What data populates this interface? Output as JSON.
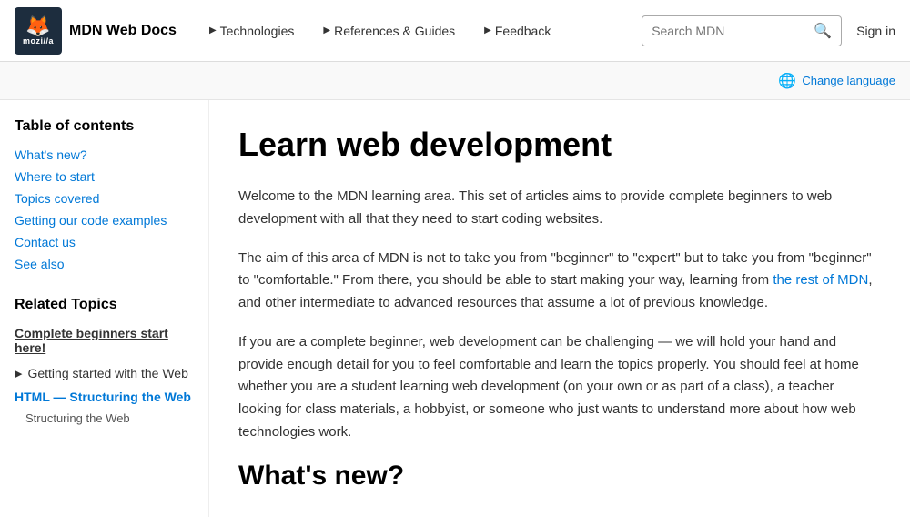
{
  "header": {
    "logo_main": "MDN Web Docs",
    "logo_sub": "mozi//a",
    "nav": [
      {
        "label": "Technologies",
        "arrow": "▶"
      },
      {
        "label": "References & Guides",
        "arrow": "▶"
      },
      {
        "label": "Feedback",
        "arrow": "▶"
      }
    ],
    "search_placeholder": "Search MDN",
    "sign_in": "Sign in"
  },
  "lang_bar": {
    "label": "Change language",
    "icon": "🌐"
  },
  "sidebar": {
    "toc_title": "Table of contents",
    "toc_links": [
      {
        "label": "What's new?"
      },
      {
        "label": "Where to start"
      },
      {
        "label": "Topics covered"
      },
      {
        "label": "Getting our code examples"
      },
      {
        "label": "Contact us"
      },
      {
        "label": "See also"
      }
    ],
    "related_title": "Related Topics",
    "related_complete": "Complete beginners start here!",
    "related_getting_started": "Getting started with the Web",
    "html_section": "HTML — Structuring the Web",
    "html_sub": "Structuring the Web"
  },
  "content": {
    "page_title": "Learn web development",
    "paragraphs": [
      "Welcome to the MDN learning area. This set of articles aims to provide complete beginners to web development with all that they need to start coding websites.",
      "The aim of this area of MDN is not to take you from \"beginner\" to \"expert\" but to take you from \"beginner\" to \"comfortable.\" From there, you should be able to start making your way, learning from the rest of MDN, and other intermediate to advanced resources that assume a lot of previous knowledge.",
      "If you are a complete beginner, web development can be challenging — we will hold your hand and provide enough detail for you to feel comfortable and learn the topics properly. You should feel at home whether you are a student learning web development (on your own or as part of a class), a teacher looking for class materials, a hobbyist, or someone who just wants to understand more about how web technologies work."
    ],
    "link_text": "the rest of MDN",
    "what_new_heading": "What's new?"
  }
}
